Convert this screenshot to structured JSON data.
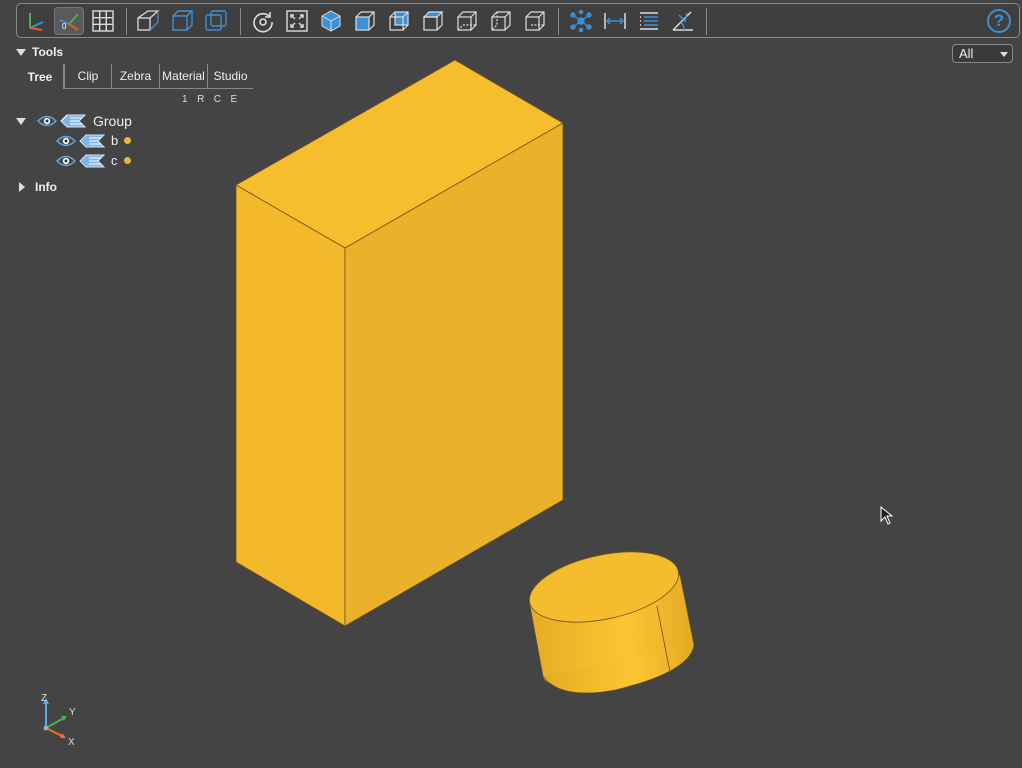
{
  "toolbar": {
    "buttons": [
      {
        "name": "axes-toggle-icon",
        "active": false
      },
      {
        "name": "axes-origin-toggle-icon",
        "active": true
      },
      {
        "name": "grid-toggle-icon",
        "active": false
      },
      {
        "name": "perspective-camera-icon",
        "active": false
      },
      {
        "name": "ortho-camera-icon",
        "active": false
      },
      {
        "name": "transparent-toggle-icon",
        "active": false
      },
      {
        "name": "reset-view-icon",
        "active": false
      },
      {
        "name": "zoom-fit-icon",
        "active": false
      },
      {
        "name": "view-iso-icon",
        "active": false
      },
      {
        "name": "view-front-icon",
        "active": false
      },
      {
        "name": "view-rear-icon",
        "active": false
      },
      {
        "name": "view-top-icon",
        "active": false
      },
      {
        "name": "view-bottom-icon",
        "active": false
      },
      {
        "name": "view-left-icon",
        "active": false
      },
      {
        "name": "view-right-icon",
        "active": false
      },
      {
        "name": "explode-icon",
        "active": false
      },
      {
        "name": "measure-distance-icon",
        "active": false
      },
      {
        "name": "properties-icon",
        "active": false
      },
      {
        "name": "measure-angle-icon",
        "active": false
      }
    ],
    "help_label": "?"
  },
  "view_select": {
    "value": "All"
  },
  "panel": {
    "tools_label": "Tools",
    "tabs": [
      "Tree",
      "Clip",
      "Zebra",
      "Material",
      "Studio"
    ],
    "selected_tab": "Tree",
    "columns": [
      "1",
      "R",
      "C",
      "E"
    ],
    "tree": {
      "group_label": "Group",
      "children": [
        {
          "label": "b",
          "color": "#e8b830"
        },
        {
          "label": "c",
          "color": "#e8b830"
        }
      ]
    },
    "info_label": "Info"
  },
  "scene": {
    "object_color": "#f2b829",
    "edge_color": "#5a4a20"
  },
  "axes": {
    "x": "X",
    "y": "Y",
    "z": "Z"
  },
  "colors": {
    "background": "#444444",
    "accent": "#3d8fd6"
  }
}
